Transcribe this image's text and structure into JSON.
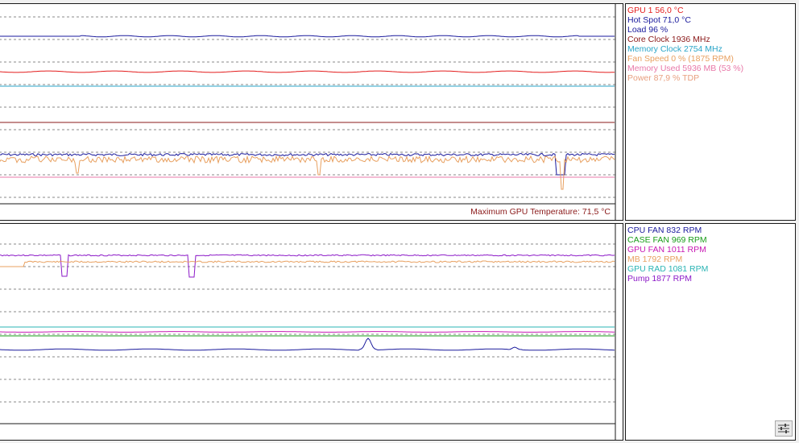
{
  "gpu_legend": [
    {
      "text": "GPU 1 56,0 °C",
      "color": "#e31c1c"
    },
    {
      "text": "Hot Spot 71,0 °C",
      "color": "#1a1a9c"
    },
    {
      "text": "Load 96 %",
      "color": "#1a1a9c"
    },
    {
      "text": "Core Clock 1936 MHz",
      "color": "#8b1a1a"
    },
    {
      "text": "Memory Clock 2754 MHz",
      "color": "#2aa5c8"
    },
    {
      "text": "Fan Speed 0 %  (1875 RPM)",
      "color": "#e8a060"
    },
    {
      "text": "Memory Used 5936 MB  (53 %)",
      "color": "#e878a8"
    },
    {
      "text": "Power 87,9 % TDP",
      "color": "#e8a080"
    }
  ],
  "max_temp_label": "Maximum GPU Temperature: 71,5 °C",
  "fan_legend": [
    {
      "text": "CPU  FAN 832 RPM",
      "color": "#1a1a9c"
    },
    {
      "text": "CASE  FAN 969 RPM",
      "color": "#1a9c1a"
    },
    {
      "text": "GPU  FAN 1011 RPM",
      "color": "#c81ab4"
    },
    {
      "text": "MB 1792 RPM",
      "color": "#e8a060"
    },
    {
      "text": "GPU  RAD 1081 RPM",
      "color": "#2ab4b4"
    },
    {
      "text": "Pump 1877 RPM",
      "color": "#8c1ac8"
    }
  ],
  "settings_icon": "sliders-icon"
}
